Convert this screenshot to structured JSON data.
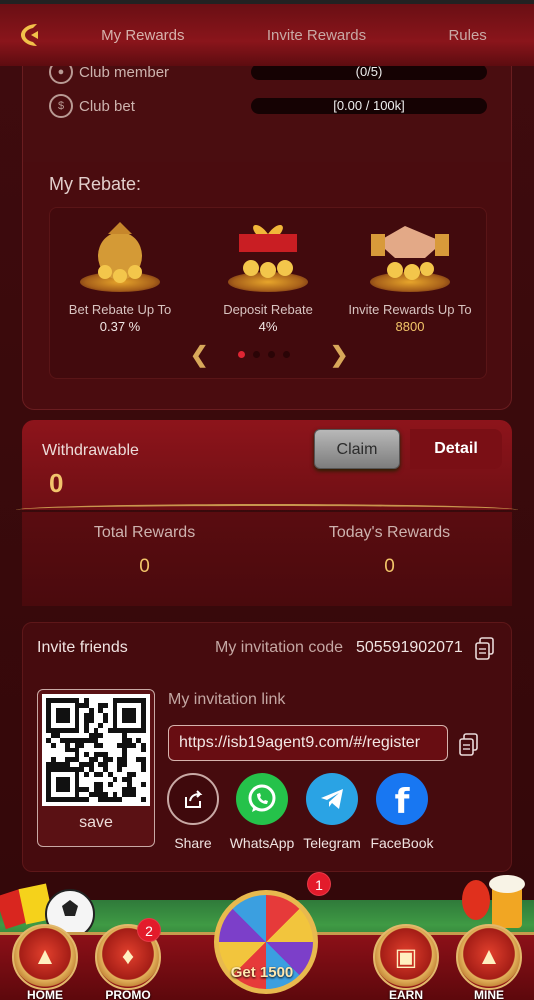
{
  "header": {
    "tabs": [
      {
        "label": "My Rewards"
      },
      {
        "label": "Invite Rewards"
      },
      {
        "label": "Rules"
      }
    ]
  },
  "club": {
    "rows": [
      {
        "label": "Club member",
        "value": "(0/5)"
      },
      {
        "label": "Club bet",
        "value": "[0.00 / 100k]"
      }
    ]
  },
  "rebate": {
    "title": "My Rebate:",
    "items": [
      {
        "caption": "Bet Rebate Up To",
        "value": "0.37 %",
        "icon": "money-bag-icon"
      },
      {
        "caption": "Deposit Rebate",
        "value": "4%",
        "icon": "gift-coins-icon"
      },
      {
        "caption": "Invite Rewards Up To",
        "value": "8800",
        "icon": "handshake-coins-icon"
      }
    ],
    "active_dot": 1,
    "dot_count": 4
  },
  "withdraw": {
    "label": "Withdrawable",
    "amount": "0",
    "claim_label": "Claim",
    "detail_label": "Detail"
  },
  "rewards": {
    "total_label": "Total Rewards",
    "total_value": "0",
    "today_label": "Today's Rewards",
    "today_value": "0"
  },
  "invite": {
    "title": "Invite friends",
    "code_label": "My invitation code",
    "code": "505591902071",
    "link_label": "My invitation link",
    "link": "https://isb19agent9.com/#/register",
    "save_label": "save",
    "share": [
      {
        "label": "Share",
        "icon": "share-icon"
      },
      {
        "label": "WhatsApp",
        "icon": "whatsapp-icon"
      },
      {
        "label": "Telegram",
        "icon": "telegram-icon"
      },
      {
        "label": "FaceBook",
        "icon": "facebook-icon"
      }
    ]
  },
  "bottom_nav": {
    "items": [
      {
        "label": "HOME"
      },
      {
        "label": "PROMO",
        "badge": "2"
      },
      {
        "label": "EARN"
      },
      {
        "label": "MINE"
      }
    ],
    "center_label": "Get 1500",
    "center_badge": "1"
  },
  "colors": {
    "accent_gold": "#f1c469",
    "badge_red": "#e31b2b",
    "background": "#3a0a0c"
  }
}
